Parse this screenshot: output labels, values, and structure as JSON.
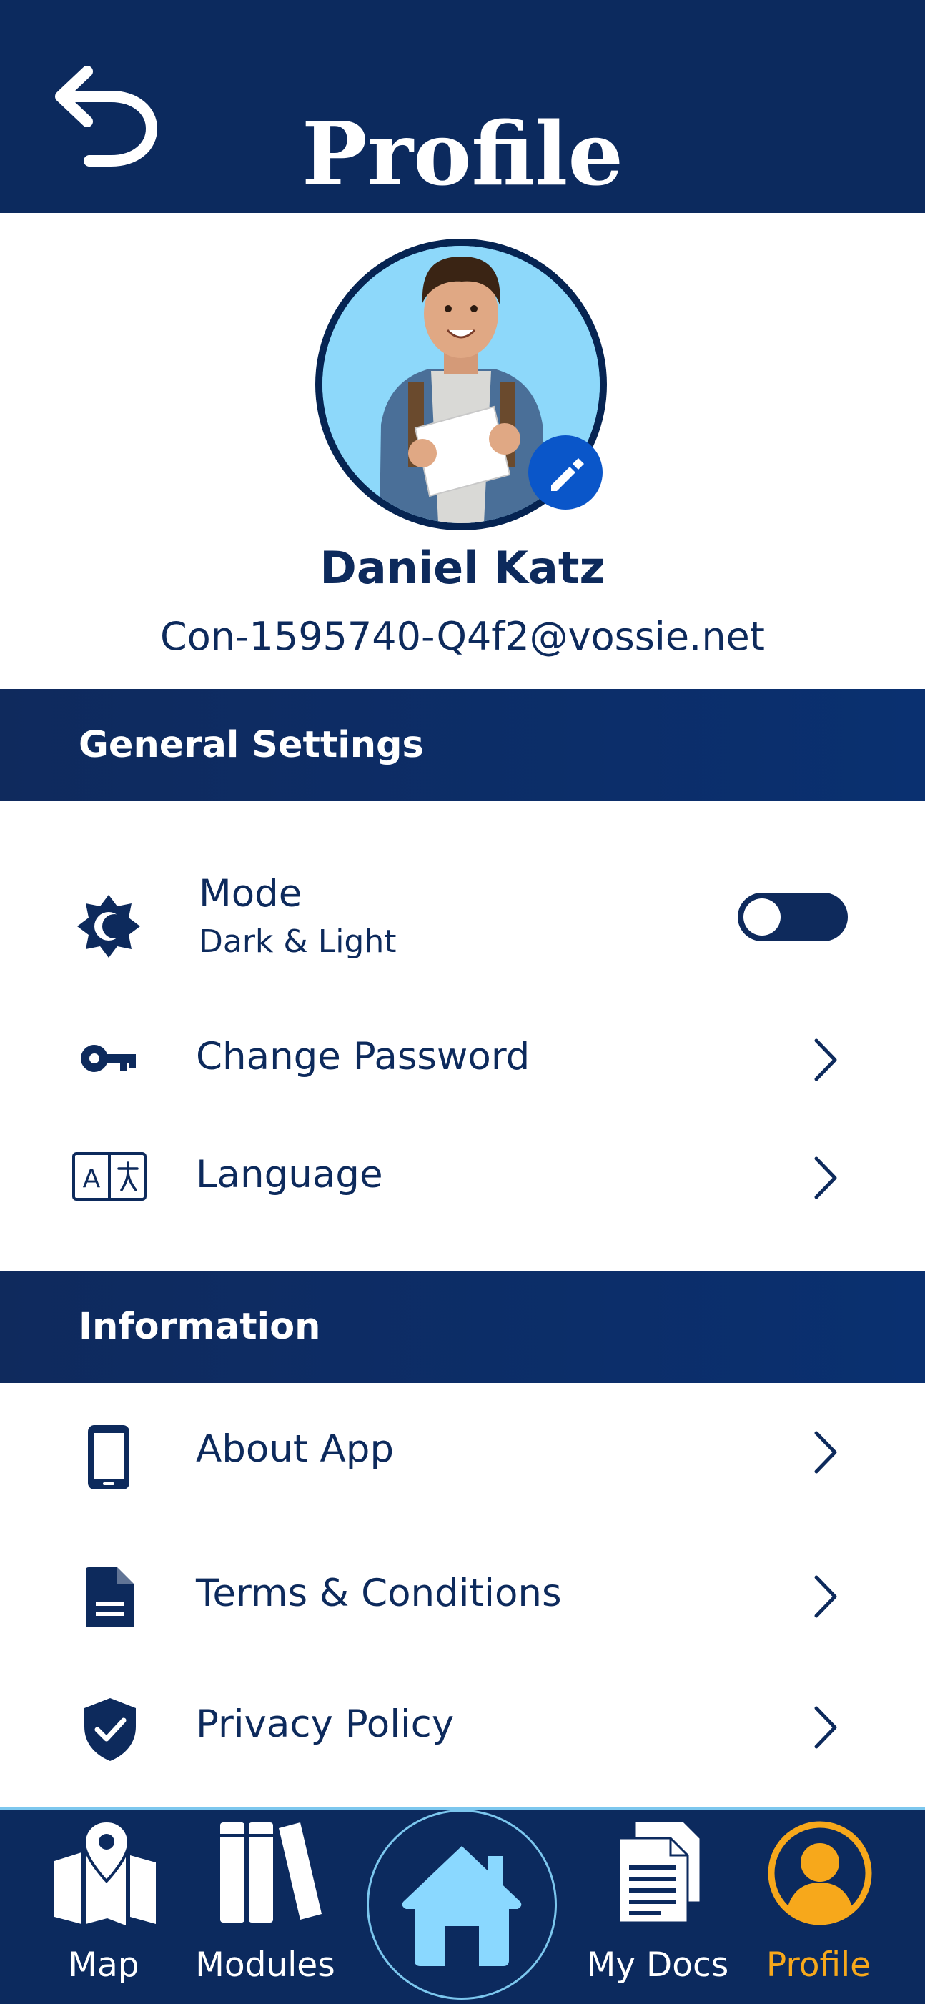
{
  "header": {
    "title": "Profile"
  },
  "user": {
    "name": "Daniel Katz",
    "email": "Con-1595740-Q4f2@vossie.net"
  },
  "sections": {
    "general": {
      "title": "General Settings",
      "mode": {
        "label": "Mode",
        "sublabel": "Dark & Light",
        "toggle_on": false
      },
      "change_password": {
        "label": "Change Password"
      },
      "language": {
        "label": "Language"
      }
    },
    "information": {
      "title": "Information",
      "about": {
        "label": "About App"
      },
      "terms": {
        "label": "Terms & Conditions"
      },
      "privacy": {
        "label": "Privacy Policy"
      }
    }
  },
  "nav": {
    "map": "Map",
    "modules": "Modules",
    "home": "",
    "docs": "My Docs",
    "profile": "Profile"
  },
  "colors": {
    "navy": "#0c2a5e",
    "active": "#f7a81b",
    "home_icon": "#8ad8ff",
    "edit_badge": "#0a56c9"
  },
  "icons": {
    "back": "undo-arrow-icon",
    "mode": "brightness-icon",
    "password": "key-icon",
    "language": "translate-icon",
    "about": "smartphone-icon",
    "terms": "document-icon",
    "privacy": "shield-check-icon"
  }
}
